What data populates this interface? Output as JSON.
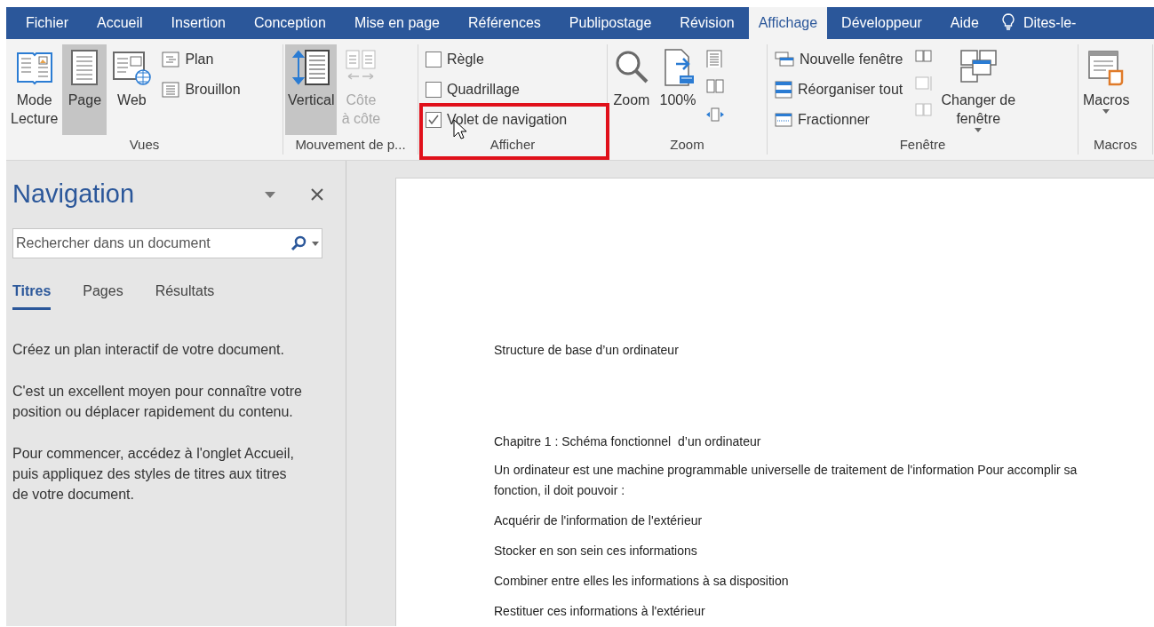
{
  "tabs": [
    {
      "label": "Fichier",
      "selected": false
    },
    {
      "label": "Accueil",
      "selected": false
    },
    {
      "label": "Insertion",
      "selected": false
    },
    {
      "label": "Conception",
      "selected": false
    },
    {
      "label": "Mise en page",
      "selected": false
    },
    {
      "label": "Références",
      "selected": false
    },
    {
      "label": "Publipostage",
      "selected": false
    },
    {
      "label": "Révision",
      "selected": false
    },
    {
      "label": "Affichage",
      "selected": true
    },
    {
      "label": "Développeur",
      "selected": false
    },
    {
      "label": "Aide",
      "selected": false
    }
  ],
  "tell_me": "Dites-le-",
  "ribbon_groups": [
    {
      "label": "Vues",
      "items": [
        {
          "kind": "large",
          "label": "Mode\nLecture",
          "selected": false,
          "disabled": false
        },
        {
          "kind": "large",
          "label": "Page",
          "selected": true,
          "disabled": false
        },
        {
          "kind": "large",
          "label": "Web",
          "selected": false,
          "disabled": false
        },
        {
          "kind": "stack",
          "items": [
            {
              "kind": "button",
              "label": "Plan"
            },
            {
              "kind": "button",
              "label": "Brouillon"
            }
          ]
        }
      ]
    },
    {
      "label": "Mouvement de p...",
      "items": [
        {
          "kind": "large",
          "label": "Vertical",
          "selected": true,
          "disabled": false
        },
        {
          "kind": "large",
          "label": "Côte\nà côte",
          "selected": false,
          "disabled": true
        }
      ]
    },
    {
      "label": "Afficher",
      "highlighted": true,
      "items": [
        {
          "kind": "stack",
          "items": [
            {
              "kind": "check",
              "label": "Règle",
              "checked": false
            },
            {
              "kind": "check",
              "label": "Quadrillage",
              "checked": false
            },
            {
              "kind": "check",
              "label": "Volet de navigation",
              "checked": true
            }
          ]
        }
      ]
    },
    {
      "label": "Zoom",
      "items": [
        {
          "kind": "large",
          "label": "Zoom",
          "selected": false,
          "disabled": false
        },
        {
          "kind": "large",
          "label": "100%",
          "selected": false,
          "disabled": false
        },
        {
          "kind": "icons"
        }
      ]
    },
    {
      "label": "Fenêtre",
      "items": [
        {
          "kind": "stack",
          "items": [
            {
              "kind": "button",
              "label": "Nouvelle fenêtre"
            },
            {
              "kind": "button",
              "label": "Réorganiser tout"
            },
            {
              "kind": "button",
              "label": "Fractionner"
            }
          ]
        },
        {
          "kind": "icons"
        },
        {
          "kind": "large",
          "label": "Changer de\nfenêtre",
          "selected": false,
          "disabled": false,
          "dropdown": true
        }
      ]
    },
    {
      "label": "Macros",
      "items": [
        {
          "kind": "large",
          "label": "Macros",
          "selected": false,
          "disabled": false,
          "dropdown": true
        }
      ]
    }
  ],
  "navigation": {
    "title": "Navigation",
    "search": {
      "placeholder": "Rechercher dans un document"
    },
    "tabs": [
      {
        "label": "Titres",
        "selected": true
      },
      {
        "label": "Pages",
        "selected": false
      },
      {
        "label": "Résultats",
        "selected": false
      }
    ],
    "paragraphs": [
      "Créez un plan interactif de votre document.",
      "C'est un excellent moyen pour connaître votre position ou déplacer rapidement du contenu.",
      "Pour commencer, accédez à l'onglet Accueil, puis appliquez des styles de titres aux titres de votre document."
    ]
  },
  "document": {
    "title": "Structure de base d’un ordinateur",
    "chapter": "Chapitre 1 : Schéma fonctionnel  d’un ordinateur",
    "paragraphs": [
      "Un ordinateur est une machine programmable universelle de traitement de l'information Pour accomplir sa fonction, il doit pouvoir :",
      "Acquérir de l'information de l'extérieur",
      "Stocker en son sein ces informations",
      "Combiner entre elles les informations à sa disposition",
      "Restituer ces informations à l'extérieur"
    ]
  }
}
